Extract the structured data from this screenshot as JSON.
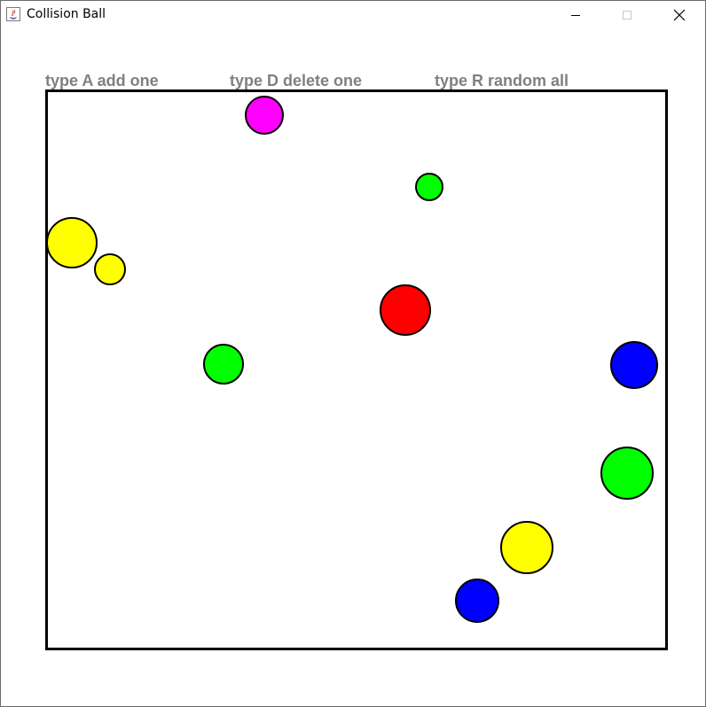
{
  "window": {
    "title": "Collision Ball",
    "icons": {
      "app": "java-icon",
      "minimize": "minimize-icon",
      "maximize": "maximize-icon",
      "close": "close-icon"
    }
  },
  "instructions": {
    "add": "type A add one",
    "delete": "type D delete one",
    "random": "type R random all"
  },
  "colors": {
    "instruction_text": "#808080",
    "border": "#000000",
    "yellow": "#ffff00",
    "green": "#00ff00",
    "red": "#ff0000",
    "blue": "#0000ff",
    "magenta": "#ff00ff"
  },
  "balls": [
    {
      "color": "magenta"
    },
    {
      "color": "green"
    },
    {
      "color": "yellow"
    },
    {
      "color": "yellow"
    },
    {
      "color": "red"
    },
    {
      "color": "green"
    },
    {
      "color": "blue"
    },
    {
      "color": "green"
    },
    {
      "color": "yellow"
    },
    {
      "color": "blue"
    }
  ]
}
